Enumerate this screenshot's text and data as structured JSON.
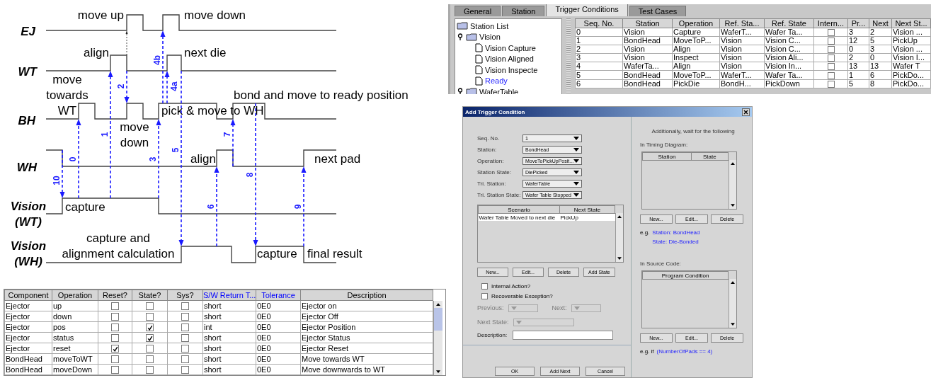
{
  "diagram": {
    "signals": [
      {
        "lines": [
          "EJ"
        ]
      },
      {
        "lines": [
          "WT"
        ]
      },
      {
        "lines": [
          "BH"
        ]
      },
      {
        "lines": [
          "WH"
        ]
      },
      {
        "lines": [
          "Vision",
          "(WT)"
        ]
      },
      {
        "lines": [
          "Vision",
          "(WH)"
        ]
      }
    ],
    "labels": [
      {
        "lines": [
          "move up"
        ]
      },
      {
        "lines": [
          "move down"
        ]
      },
      {
        "lines": [
          "align"
        ]
      },
      {
        "lines": [
          "next die"
        ]
      },
      {
        "lines": [
          "move",
          "towards",
          "WT"
        ]
      },
      {
        "lines": [
          "bond and move to ready position"
        ]
      },
      {
        "lines": [
          "pick & move to WH"
        ]
      },
      {
        "lines": [
          "move",
          "down"
        ]
      },
      {
        "lines": [
          "align"
        ]
      },
      {
        "lines": [
          "next pad"
        ]
      },
      {
        "lines": [
          "capture"
        ]
      },
      {
        "lines": [
          "capture and",
          "alignment calculation"
        ]
      },
      {
        "lines": [
          "capture"
        ]
      },
      {
        "lines": [
          "final result"
        ]
      }
    ],
    "arrows": [
      {
        "label": "10"
      },
      {
        "label": "0"
      },
      {
        "label": "1"
      },
      {
        "label": "2"
      },
      {
        "label": "3"
      },
      {
        "label": "4b"
      },
      {
        "label": "4a"
      },
      {
        "label": "5"
      },
      {
        "label": "6"
      },
      {
        "label": "7"
      },
      {
        "label": "8"
      },
      {
        "label": "9"
      }
    ]
  },
  "operations_table": {
    "columns": [
      {
        "label": "Component"
      },
      {
        "label": "Operation"
      },
      {
        "label": "Reset?"
      },
      {
        "label": "State?"
      },
      {
        "label": "Sys?"
      },
      {
        "label": "S/W Return T...",
        "color": "#0000ff"
      },
      {
        "label": "Tolerance",
        "color": "#0000ff"
      },
      {
        "label": "Description"
      }
    ],
    "rows": [
      {
        "component": "Ejector",
        "operation": "up",
        "reset": false,
        "state": false,
        "sys": false,
        "return_type": "short",
        "tolerance": "0E0",
        "description": "Ejector on"
      },
      {
        "component": "Ejector",
        "operation": "down",
        "reset": false,
        "state": false,
        "sys": false,
        "return_type": "short",
        "tolerance": "0E0",
        "description": "Ejector Off"
      },
      {
        "component": "Ejector",
        "operation": "pos",
        "reset": false,
        "state": true,
        "sys": false,
        "return_type": "int",
        "tolerance": "0E0",
        "description": "Ejector Position"
      },
      {
        "component": "Ejector",
        "operation": "status",
        "reset": false,
        "state": true,
        "sys": false,
        "return_type": "short",
        "tolerance": "0E0",
        "description": "Ejector Status"
      },
      {
        "component": "Ejector",
        "operation": "reset",
        "reset": true,
        "state": false,
        "sys": false,
        "return_type": "short",
        "tolerance": "0E0",
        "description": "Ejector Reset"
      },
      {
        "component": "BondHead",
        "operation": "moveToWT",
        "reset": false,
        "state": false,
        "sys": false,
        "return_type": "short",
        "tolerance": "0E0",
        "description": "Move towards WT"
      },
      {
        "component": "BondHead",
        "operation": "moveDown",
        "reset": false,
        "state": false,
        "sys": false,
        "return_type": "short",
        "tolerance": "0E0",
        "description": "Move downwards to WT"
      }
    ]
  },
  "editor": {
    "tabs": [
      {
        "label": "General",
        "selected": false
      },
      {
        "label": "Station",
        "selected": false
      },
      {
        "label": "Trigger Conditions",
        "selected": true
      },
      {
        "label": "Test Cases",
        "selected": false
      }
    ],
    "tree": [
      {
        "label": "Station List",
        "kind": "list",
        "selected": false
      },
      {
        "label": "Vision",
        "kind": "group",
        "selected": false,
        "children": [
          {
            "label": "Vision Capture",
            "kind": "leaf",
            "selected": false
          },
          {
            "label": "Vision Aligned",
            "kind": "leaf",
            "selected": false
          },
          {
            "label": "Vision Inspecte",
            "kind": "leaf",
            "selected": false
          },
          {
            "label": "Ready",
            "kind": "leaf",
            "selected": true
          }
        ]
      },
      {
        "label": "WaferTable",
        "kind": "group",
        "selected": false
      }
    ],
    "table": {
      "columns": [
        "Seq. No.",
        "Station",
        "Operation",
        "Ref. Sta...",
        "Ref. State",
        "Intern...",
        "Pr...",
        "Next",
        "Next St..."
      ],
      "rows": [
        {
          "cells": [
            "0",
            "Vision",
            "Capture",
            "WaferT...",
            "Wafer Ta...",
            "",
            "3",
            "2",
            "Vision ..."
          ],
          "internal": false
        },
        {
          "cells": [
            "1",
            "BondHead",
            "MoveToP...",
            "Vision",
            "Vision C...",
            "",
            "12",
            "5",
            "PickUp"
          ],
          "internal": false
        },
        {
          "cells": [
            "2",
            "Vision",
            "Align",
            "Vision",
            "Vision C...",
            "",
            "0",
            "3",
            "Vision ..."
          ],
          "internal": false
        },
        {
          "cells": [
            "3",
            "Vision",
            "Inspect",
            "Vision",
            "Vision Ali...",
            "",
            "2",
            "0",
            "Vision I..."
          ],
          "internal": false
        },
        {
          "cells": [
            "4",
            "WaferTa...",
            "Align",
            "Vision",
            "Vision In...",
            "",
            "13",
            "13",
            "Wafer T"
          ],
          "internal": false
        },
        {
          "cells": [
            "5",
            "BondHead",
            "MoveToP...",
            "WaferT...",
            "Wafer Ta...",
            "",
            "1",
            "6",
            "PickDo..."
          ],
          "internal": false
        },
        {
          "cells": [
            "6",
            "BondHead",
            "PickDie",
            "BondH...",
            "PickDown",
            "",
            "5",
            "8",
            "PickDo..."
          ],
          "internal": false
        }
      ]
    }
  },
  "dialog": {
    "title": "Add Trigger Condition",
    "form": [
      {
        "label": "Seq. No.",
        "value": "1"
      },
      {
        "label": "Station:",
        "value": "BondHead"
      },
      {
        "label": "Operation:",
        "value": "MoveToPickUpPosit..."
      },
      {
        "label": "Station State:",
        "value": "DiePicked"
      },
      {
        "label": "Tri. Station:",
        "value": "WaferTable"
      },
      {
        "label": "Tri. Station State:",
        "value": "Wafer Table Stopped"
      }
    ],
    "scenario_table": {
      "columns": [
        "Scenario",
        "Next State"
      ],
      "rows": [
        [
          "Wafer Table Moved to next die",
          "PickUp"
        ]
      ]
    },
    "scenario_buttons": [
      "New...",
      "Edit...",
      "Delete",
      "Add State"
    ],
    "options": [
      {
        "label": "Internal Action?",
        "checked": false
      },
      {
        "label": "Recoverable Exception?",
        "checked": false
      }
    ],
    "transition_fields": [
      {
        "label": "Previous:",
        "disabled": true
      },
      {
        "label": "Next:",
        "disabled": true
      },
      {
        "label": "Next State:",
        "disabled": true
      }
    ],
    "description_label": "Description:",
    "footer_buttons": [
      "OK",
      "Add Next",
      "Cancel"
    ],
    "heading": "Additionally, wait for the following",
    "timing_label": "In Timing Diagram:",
    "timing_columns": [
      "Station",
      "State"
    ],
    "timing_buttons": [
      "New...",
      "Edit...",
      "Delete"
    ],
    "timing_example_prefix": "e.g.",
    "timing_example": [
      "Station: BondHead",
      "State: Die-Bonded"
    ],
    "source_label": "In Source Code:",
    "source_columns": [
      "Program Condition"
    ],
    "source_buttons": [
      "New...",
      "Edit...",
      "Delete"
    ],
    "source_example_prefix": "e.g. if",
    "source_example": "(NumberOfPads == 4)"
  }
}
